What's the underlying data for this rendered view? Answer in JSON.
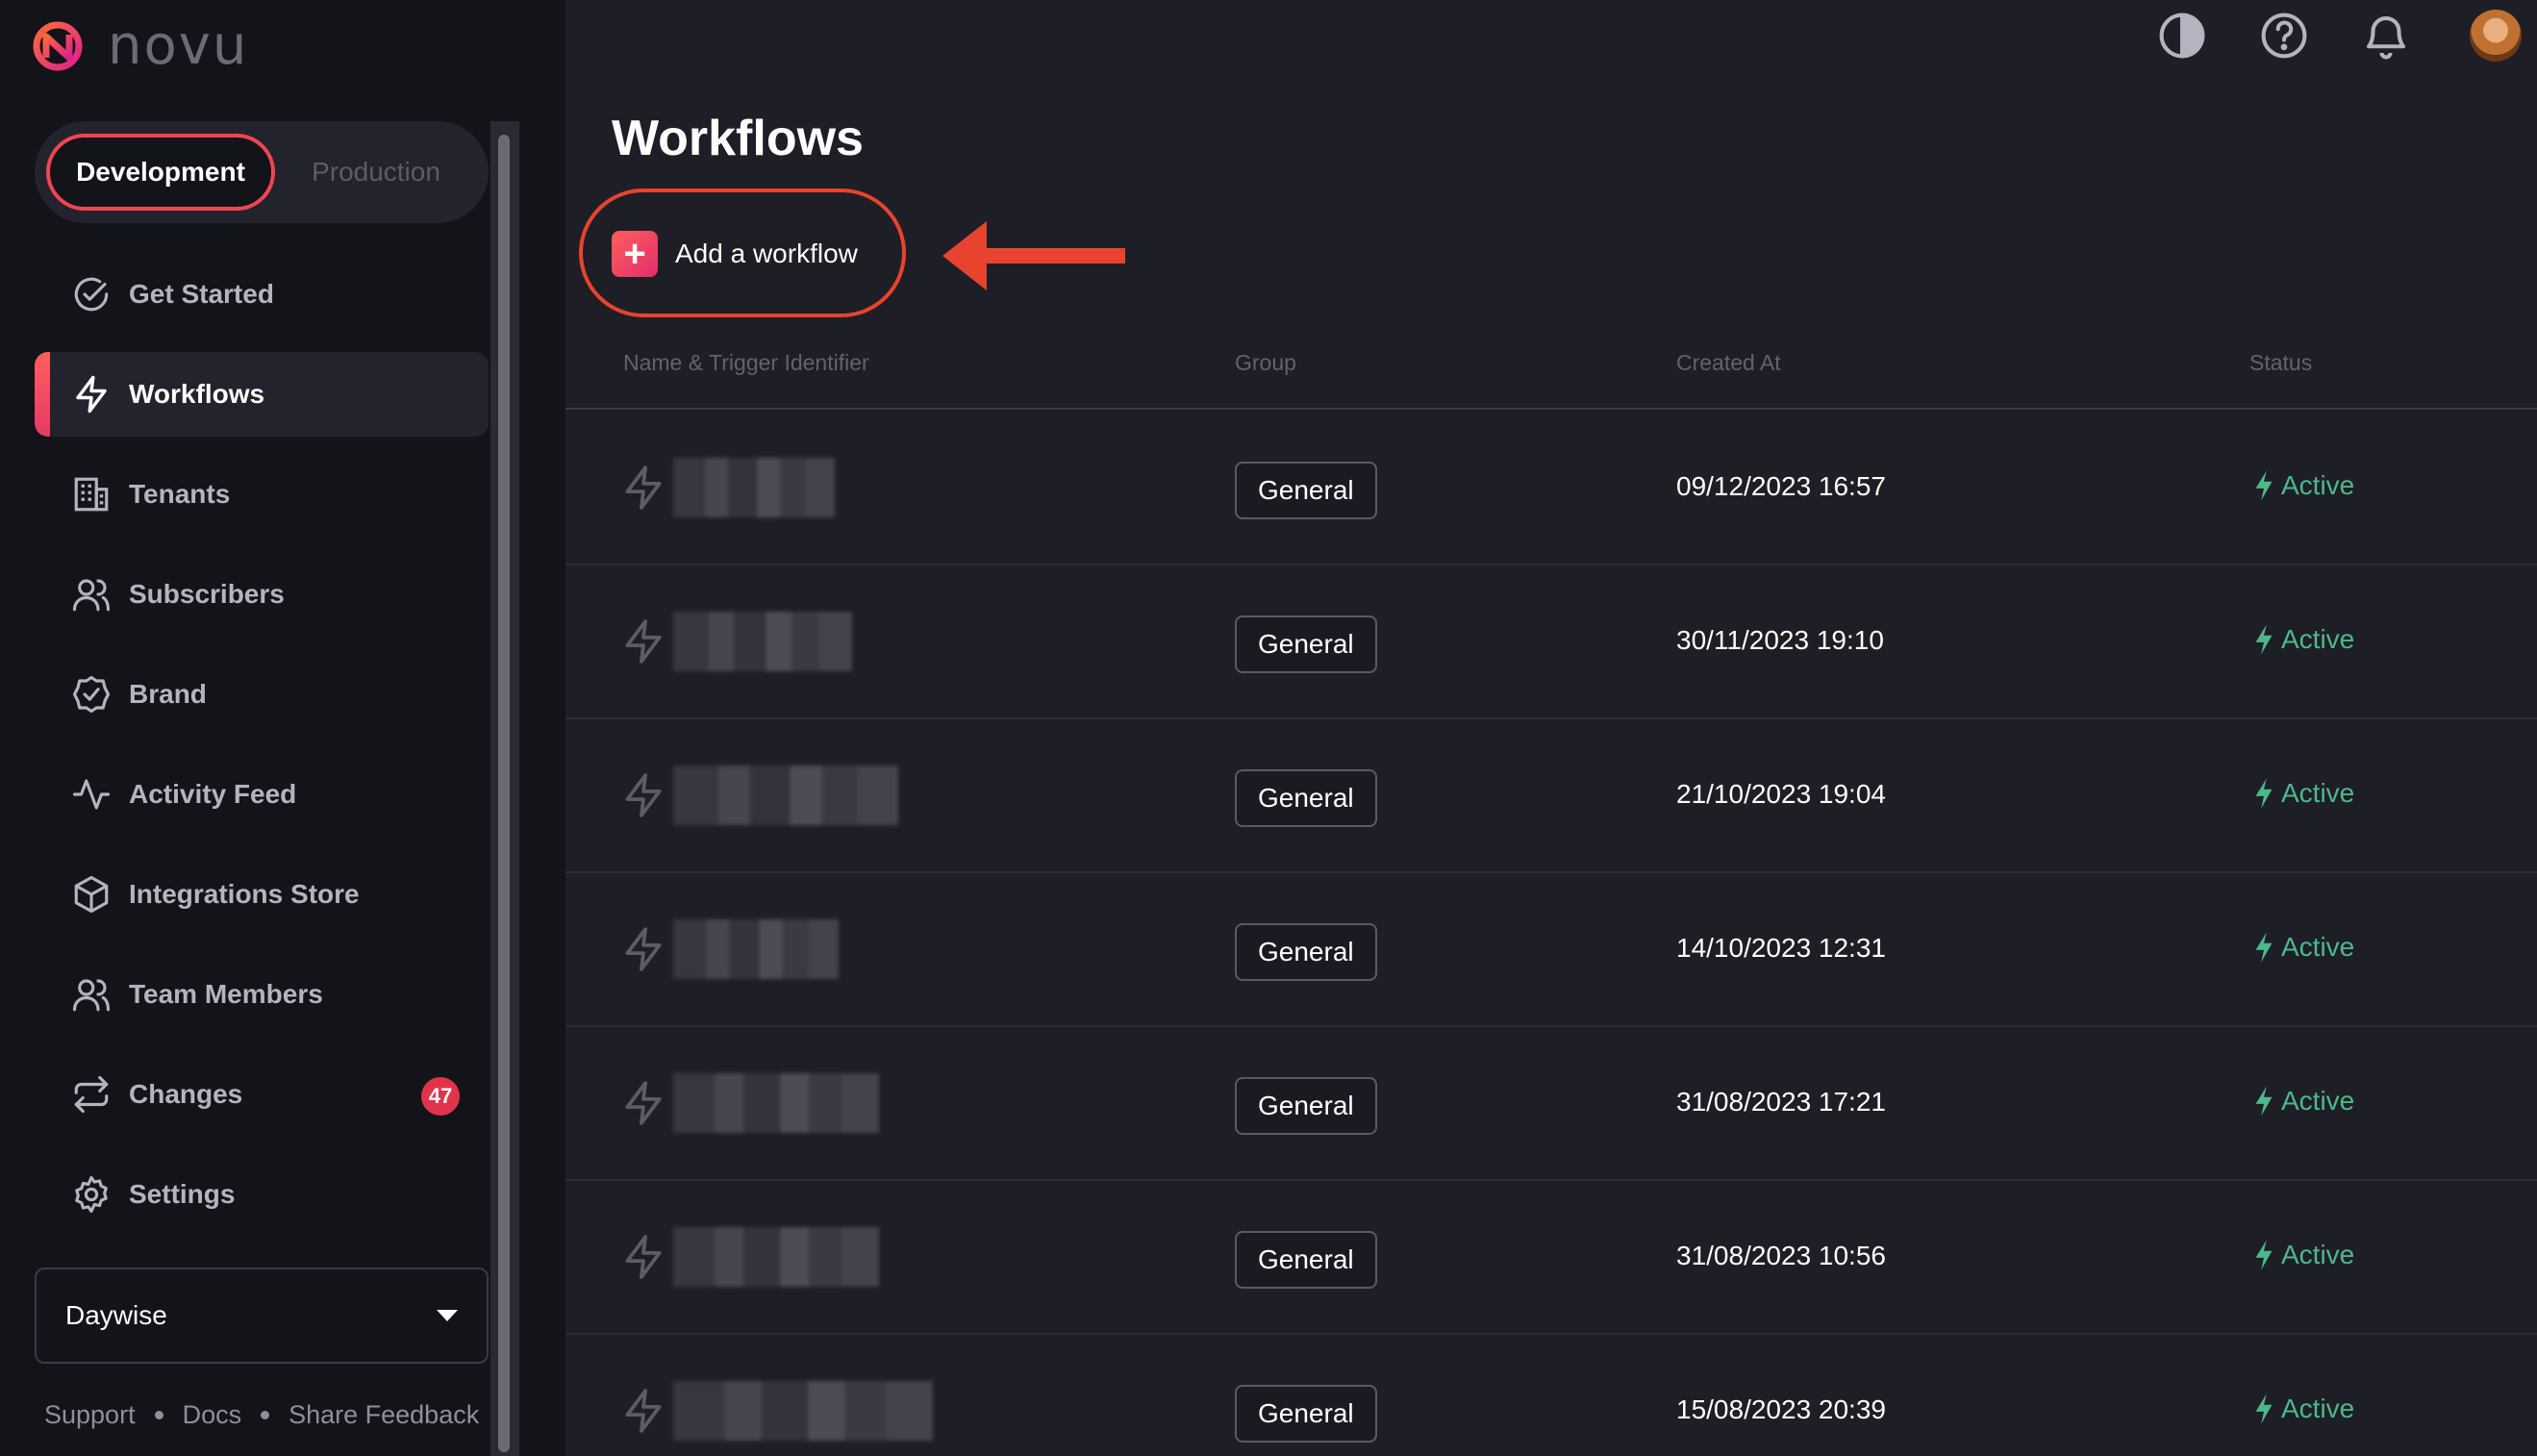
{
  "brand": {
    "name": "novu",
    "accent": "#f04552"
  },
  "environment": {
    "options": [
      "Development",
      "Production"
    ],
    "selected": "Development"
  },
  "sidebar": {
    "items": [
      {
        "label": "Get Started",
        "icon": "check-circle-icon"
      },
      {
        "label": "Workflows",
        "icon": "bolt-icon",
        "active": true
      },
      {
        "label": "Tenants",
        "icon": "building-icon"
      },
      {
        "label": "Subscribers",
        "icon": "users-icon"
      },
      {
        "label": "Brand",
        "icon": "badge-check-icon"
      },
      {
        "label": "Activity Feed",
        "icon": "activity-icon"
      },
      {
        "label": "Integrations Store",
        "icon": "box-icon"
      },
      {
        "label": "Team Members",
        "icon": "team-icon"
      },
      {
        "label": "Changes",
        "icon": "repeat-icon",
        "badge": "47"
      },
      {
        "label": "Settings",
        "icon": "gear-icon"
      }
    ],
    "organization": "Daywise",
    "footer": {
      "support": "Support",
      "docs": "Docs",
      "feedback": "Share Feedback"
    }
  },
  "main": {
    "title": "Workflows",
    "add_button": "Add a workflow",
    "columns": {
      "name": "Name & Trigger Identifier",
      "group": "Group",
      "created": "Created At",
      "status": "Status"
    },
    "rows": [
      {
        "group": "General",
        "created_at": "09/12/2023 16:57",
        "status": "Active"
      },
      {
        "group": "General",
        "created_at": "30/11/2023 19:10",
        "status": "Active"
      },
      {
        "group": "General",
        "created_at": "21/10/2023 19:04",
        "status": "Active"
      },
      {
        "group": "General",
        "created_at": "14/10/2023 12:31",
        "status": "Active"
      },
      {
        "group": "General",
        "created_at": "31/08/2023 17:21",
        "status": "Active"
      },
      {
        "group": "General",
        "created_at": "31/08/2023 10:56",
        "status": "Active"
      },
      {
        "group": "General",
        "created_at": "15/08/2023 20:39",
        "status": "Active"
      }
    ]
  },
  "colors": {
    "status_active": "#4db88a",
    "annotation": "#e8432e",
    "badge": "#e0344a"
  }
}
